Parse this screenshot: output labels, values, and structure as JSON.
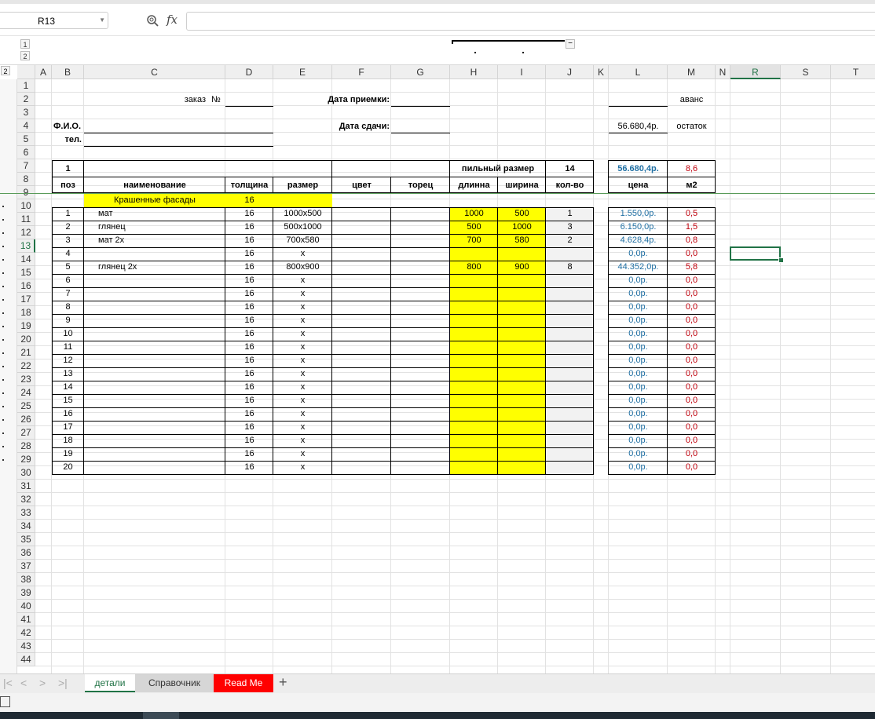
{
  "formula_bar": {
    "name_box": "R13",
    "formula": ""
  },
  "outline": {
    "levels": [
      "1",
      "2"
    ],
    "row_level": "2"
  },
  "columns": [
    "A",
    "B",
    "C",
    "D",
    "E",
    "F",
    "G",
    "H",
    "I",
    "J",
    "K",
    "L",
    "M",
    "N",
    "R",
    "S",
    "T"
  ],
  "selected_column": "R",
  "rows": [
    "1",
    "2",
    "3",
    "4",
    "5",
    "6",
    "7",
    "8",
    "9",
    "10",
    "11",
    "12",
    "13",
    "14",
    "15",
    "16",
    "17",
    "18",
    "19",
    "20",
    "21",
    "22",
    "23",
    "24",
    "25",
    "26",
    "27",
    "28",
    "29",
    "30",
    "31",
    "32",
    "33",
    "34",
    "35",
    "36",
    "37",
    "38",
    "39",
    "40",
    "41",
    "42",
    "43",
    "44"
  ],
  "selected_row": "13",
  "header_form": {
    "order_label": "заказ",
    "no_label": "№",
    "receive_date_label": "Дата приемки:",
    "deliver_date_label": "Дата сдачи:",
    "name_label": "Ф.И.О.",
    "phone_label": "тел.",
    "advance_label": "аванс",
    "balance_value": "56.680,4р.",
    "balance_label": "остаток"
  },
  "summary_row": {
    "b": "1",
    "saw_size_label": "пильный размер",
    "count_total": "14",
    "price_total": "56.680,4р.",
    "m2_total": "8,6"
  },
  "table_headers": {
    "pos": "поз",
    "name": "наименование",
    "thickness": "толщина",
    "size": "размер",
    "color": "цвет",
    "edge": "торец",
    "length": "длинна",
    "width": "ширина",
    "qty": "кол-во",
    "price": "цена",
    "m2": "м2"
  },
  "section": {
    "title": "Крашенные фасады",
    "thickness": "16"
  },
  "items": [
    {
      "pos": "1",
      "name": "мат",
      "thk": "16",
      "size": "1000х500",
      "len": "1000",
      "wid": "500",
      "qty": "1",
      "price": "1.550,0р.",
      "m2": "0,5"
    },
    {
      "pos": "2",
      "name": "глянец",
      "thk": "16",
      "size": "500х1000",
      "len": "500",
      "wid": "1000",
      "qty": "3",
      "price": "6.150,0р.",
      "m2": "1,5"
    },
    {
      "pos": "3",
      "name": "мат 2х",
      "thk": "16",
      "size": "700х580",
      "len": "700",
      "wid": "580",
      "qty": "2",
      "price": "4.628,4р.",
      "m2": "0,8"
    },
    {
      "pos": "4",
      "name": "",
      "thk": "16",
      "size": "х",
      "len": "",
      "wid": "",
      "qty": "",
      "price": "0,0р.",
      "m2": "0,0"
    },
    {
      "pos": "5",
      "name": "глянец 2х",
      "thk": "16",
      "size": "800х900",
      "len": "800",
      "wid": "900",
      "qty": "8",
      "price": "44.352,0р.",
      "m2": "5,8"
    },
    {
      "pos": "6",
      "name": "",
      "thk": "16",
      "size": "х",
      "len": "",
      "wid": "",
      "qty": "",
      "price": "0,0р.",
      "m2": "0,0"
    },
    {
      "pos": "7",
      "name": "",
      "thk": "16",
      "size": "х",
      "len": "",
      "wid": "",
      "qty": "",
      "price": "0,0р.",
      "m2": "0,0"
    },
    {
      "pos": "8",
      "name": "",
      "thk": "16",
      "size": "х",
      "len": "",
      "wid": "",
      "qty": "",
      "price": "0,0р.",
      "m2": "0,0"
    },
    {
      "pos": "9",
      "name": "",
      "thk": "16",
      "size": "х",
      "len": "",
      "wid": "",
      "qty": "",
      "price": "0,0р.",
      "m2": "0,0"
    },
    {
      "pos": "10",
      "name": "",
      "thk": "16",
      "size": "х",
      "len": "",
      "wid": "",
      "qty": "",
      "price": "0,0р.",
      "m2": "0,0"
    },
    {
      "pos": "11",
      "name": "",
      "thk": "16",
      "size": "х",
      "len": "",
      "wid": "",
      "qty": "",
      "price": "0,0р.",
      "m2": "0,0"
    },
    {
      "pos": "12",
      "name": "",
      "thk": "16",
      "size": "х",
      "len": "",
      "wid": "",
      "qty": "",
      "price": "0,0р.",
      "m2": "0,0"
    },
    {
      "pos": "13",
      "name": "",
      "thk": "16",
      "size": "х",
      "len": "",
      "wid": "",
      "qty": "",
      "price": "0,0р.",
      "m2": "0,0"
    },
    {
      "pos": "14",
      "name": "",
      "thk": "16",
      "size": "х",
      "len": "",
      "wid": "",
      "qty": "",
      "price": "0,0р.",
      "m2": "0,0"
    },
    {
      "pos": "15",
      "name": "",
      "thk": "16",
      "size": "х",
      "len": "",
      "wid": "",
      "qty": "",
      "price": "0,0р.",
      "m2": "0,0"
    },
    {
      "pos": "16",
      "name": "",
      "thk": "16",
      "size": "х",
      "len": "",
      "wid": "",
      "qty": "",
      "price": "0,0р.",
      "m2": "0,0"
    },
    {
      "pos": "17",
      "name": "",
      "thk": "16",
      "size": "х",
      "len": "",
      "wid": "",
      "qty": "",
      "price": "0,0р.",
      "m2": "0,0"
    },
    {
      "pos": "18",
      "name": "",
      "thk": "16",
      "size": "х",
      "len": "",
      "wid": "",
      "qty": "",
      "price": "0,0р.",
      "m2": "0,0"
    },
    {
      "pos": "19",
      "name": "",
      "thk": "16",
      "size": "х",
      "len": "",
      "wid": "",
      "qty": "",
      "price": "0,0р.",
      "m2": "0,0"
    },
    {
      "pos": "20",
      "name": "",
      "thk": "16",
      "size": "х",
      "len": "",
      "wid": "",
      "qty": "",
      "price": "0,0р.",
      "m2": "0,0"
    }
  ],
  "sheet_tabs": [
    {
      "label": "детали",
      "active": true
    },
    {
      "label": "Справочник",
      "active": false
    },
    {
      "label": "Read Me",
      "active": false
    }
  ],
  "colors": {
    "accent": "#217346",
    "yellow": "#ffff00",
    "price_blue": "#1f6fa3",
    "m2_red": "#c0000c",
    "tab_red": "#ff0000"
  }
}
